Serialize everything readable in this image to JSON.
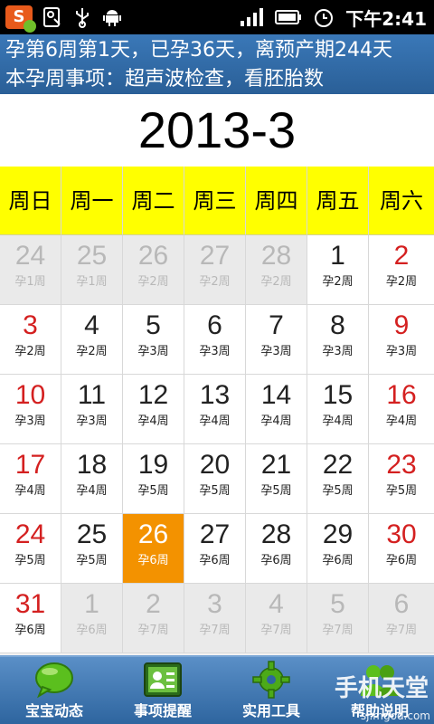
{
  "status_bar": {
    "time": "下午2:41",
    "icons": [
      "app-badge-icon",
      "image-icon",
      "usb-icon",
      "android-icon",
      "signal-icon",
      "battery-icon",
      "alarm-icon"
    ]
  },
  "header": {
    "line1": "孕第6周第1天，已孕36天，离预产期244天",
    "line2": "本孕周事项：超声波检查，看胚胎数"
  },
  "month_title": "2013-3",
  "weekdays": [
    "周日",
    "周一",
    "周二",
    "周三",
    "周四",
    "周五",
    "周六"
  ],
  "weeks": [
    [
      {
        "day": "24",
        "week": "孕1周",
        "state": "out"
      },
      {
        "day": "25",
        "week": "孕1周",
        "state": "out"
      },
      {
        "day": "26",
        "week": "孕2周",
        "state": "out"
      },
      {
        "day": "27",
        "week": "孕2周",
        "state": "out"
      },
      {
        "day": "28",
        "week": "孕2周",
        "state": "out"
      },
      {
        "day": "1",
        "week": "孕2周",
        "state": "normal"
      },
      {
        "day": "2",
        "week": "孕2周",
        "state": "red"
      }
    ],
    [
      {
        "day": "3",
        "week": "孕2周",
        "state": "red"
      },
      {
        "day": "4",
        "week": "孕2周",
        "state": "normal"
      },
      {
        "day": "5",
        "week": "孕3周",
        "state": "normal"
      },
      {
        "day": "6",
        "week": "孕3周",
        "state": "normal"
      },
      {
        "day": "7",
        "week": "孕3周",
        "state": "normal"
      },
      {
        "day": "8",
        "week": "孕3周",
        "state": "normal"
      },
      {
        "day": "9",
        "week": "孕3周",
        "state": "red"
      }
    ],
    [
      {
        "day": "10",
        "week": "孕3周",
        "state": "red"
      },
      {
        "day": "11",
        "week": "孕3周",
        "state": "normal"
      },
      {
        "day": "12",
        "week": "孕4周",
        "state": "normal"
      },
      {
        "day": "13",
        "week": "孕4周",
        "state": "normal"
      },
      {
        "day": "14",
        "week": "孕4周",
        "state": "normal"
      },
      {
        "day": "15",
        "week": "孕4周",
        "state": "normal"
      },
      {
        "day": "16",
        "week": "孕4周",
        "state": "red"
      }
    ],
    [
      {
        "day": "17",
        "week": "孕4周",
        "state": "red"
      },
      {
        "day": "18",
        "week": "孕4周",
        "state": "normal"
      },
      {
        "day": "19",
        "week": "孕5周",
        "state": "normal"
      },
      {
        "day": "20",
        "week": "孕5周",
        "state": "normal"
      },
      {
        "day": "21",
        "week": "孕5周",
        "state": "normal"
      },
      {
        "day": "22",
        "week": "孕5周",
        "state": "normal"
      },
      {
        "day": "23",
        "week": "孕5周",
        "state": "red"
      }
    ],
    [
      {
        "day": "24",
        "week": "孕5周",
        "state": "red"
      },
      {
        "day": "25",
        "week": "孕5周",
        "state": "normal"
      },
      {
        "day": "26",
        "week": "孕6周",
        "state": "sel"
      },
      {
        "day": "27",
        "week": "孕6周",
        "state": "normal"
      },
      {
        "day": "28",
        "week": "孕6周",
        "state": "normal"
      },
      {
        "day": "29",
        "week": "孕6周",
        "state": "normal"
      },
      {
        "day": "30",
        "week": "孕6周",
        "state": "red"
      }
    ],
    [
      {
        "day": "31",
        "week": "孕6周",
        "state": "red"
      },
      {
        "day": "1",
        "week": "孕6周",
        "state": "out"
      },
      {
        "day": "2",
        "week": "孕7周",
        "state": "out"
      },
      {
        "day": "3",
        "week": "孕7周",
        "state": "out"
      },
      {
        "day": "4",
        "week": "孕7周",
        "state": "out"
      },
      {
        "day": "5",
        "week": "孕7周",
        "state": "out"
      },
      {
        "day": "6",
        "week": "孕7周",
        "state": "out"
      }
    ]
  ],
  "nav": [
    {
      "label": "宝宝动态",
      "icon": "chat-bubble-icon"
    },
    {
      "label": "事项提醒",
      "icon": "contact-card-icon"
    },
    {
      "label": "实用工具",
      "icon": "gear-icon"
    },
    {
      "label": "帮助说明",
      "icon": "people-icon"
    }
  ],
  "watermark": {
    "title": "手机天堂",
    "url": "sj.mgod.com"
  },
  "colors": {
    "header": "#2f6aa6",
    "weekday_bg": "#ffff00",
    "selected": "#f39200",
    "weekend_red": "#d42020",
    "out_of_month": "#eaeaea"
  }
}
